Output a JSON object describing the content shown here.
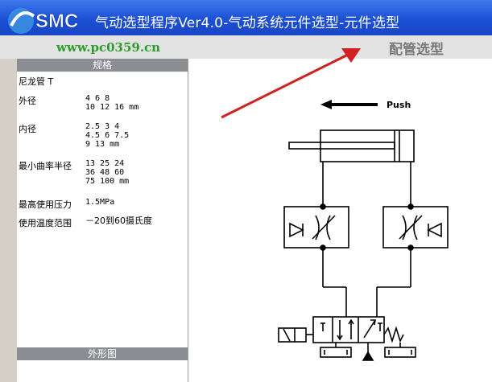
{
  "window": {
    "title": "气动选型程序Ver4.0-气动系统元件选型-元件选型",
    "logo_text": "SMC"
  },
  "watermark": "www.pc0359.cn",
  "section_title": "配管选型",
  "specs": {
    "header": "规格",
    "material": "尼龙管  T",
    "rows": [
      {
        "label": "外径",
        "lines": [
          "4    6    8",
          "10   12   16 mm"
        ]
      },
      {
        "label": "内径",
        "lines": [
          "2.5  3    4",
          "4.5  6    7.5",
          "9    13 mm"
        ]
      },
      {
        "label": "最小曲率半径",
        "lines": [
          "13   25   24",
          "36   48   60",
          "75   100  mm"
        ]
      },
      {
        "label": "最高使用压力",
        "lines": [
          "1.5MPa"
        ]
      },
      {
        "label": "使用温度范围",
        "lines": [
          "－20到60摄氏度"
        ]
      }
    ]
  },
  "outline_header": "外形图",
  "diagram": {
    "push_label": "Push"
  },
  "colors": {
    "titlebar": "#1b4fd4",
    "panel_header": "#8a8d92",
    "watermark": "#2d9b2d",
    "arrow": "#d22020"
  }
}
